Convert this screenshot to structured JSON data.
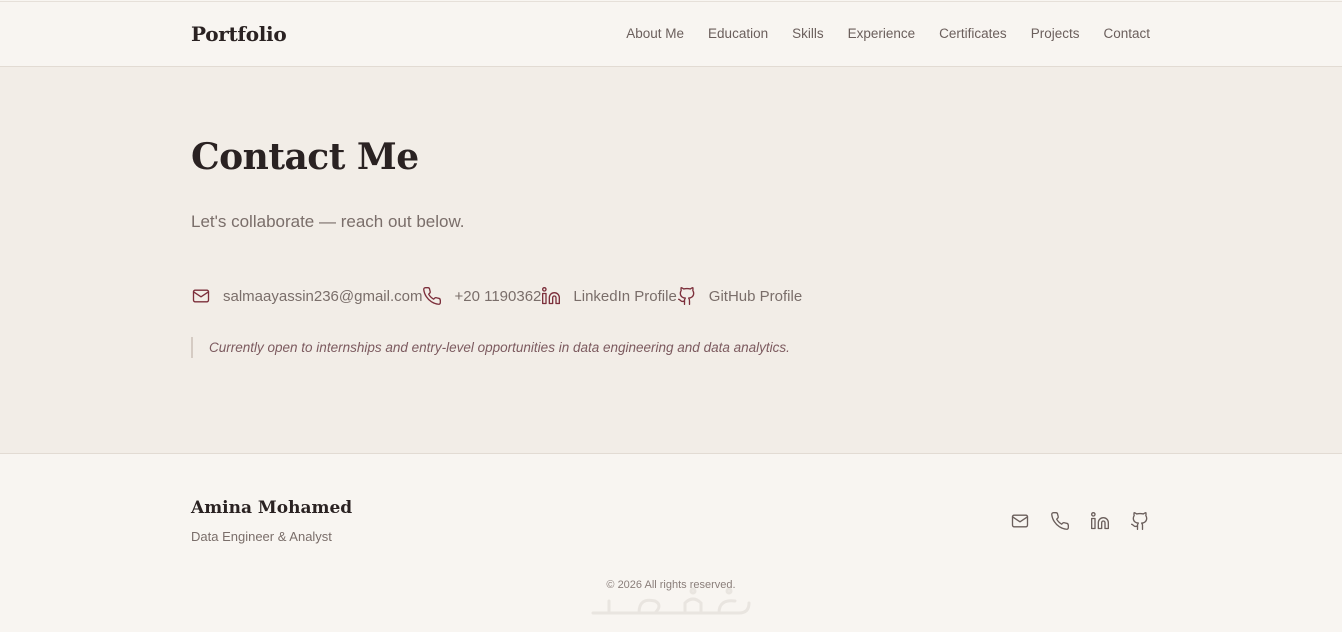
{
  "nav": {
    "brand": "Portfolio",
    "links": [
      "About Me",
      "Education",
      "Skills",
      "Experience",
      "Certificates",
      "Projects",
      "Contact"
    ]
  },
  "contact": {
    "title": "Contact Me",
    "subtitle": "Let's collaborate — reach out below.",
    "items": [
      {
        "icon": "mail-icon",
        "label": "salmaayassin236@gmail.com"
      },
      {
        "icon": "phone-icon",
        "label": "+20 1190362"
      },
      {
        "icon": "linkedin-icon",
        "label": "LinkedIn Profile"
      },
      {
        "icon": "github-icon",
        "label": "GitHub Profile"
      }
    ],
    "note": "Currently open to internships and entry-level opportunities in data engineering and data analytics."
  },
  "footer": {
    "name": "Amina Mohamed",
    "role": "Data Engineer & Analyst",
    "icons": [
      "mail-icon",
      "phone-icon",
      "linkedin-icon",
      "github-icon"
    ],
    "copyright": "© 2026 All rights reserved."
  },
  "colors": {
    "accent": "#7c2f3b",
    "background": "#f2ede7",
    "header_bg": "#f8f5f1"
  }
}
